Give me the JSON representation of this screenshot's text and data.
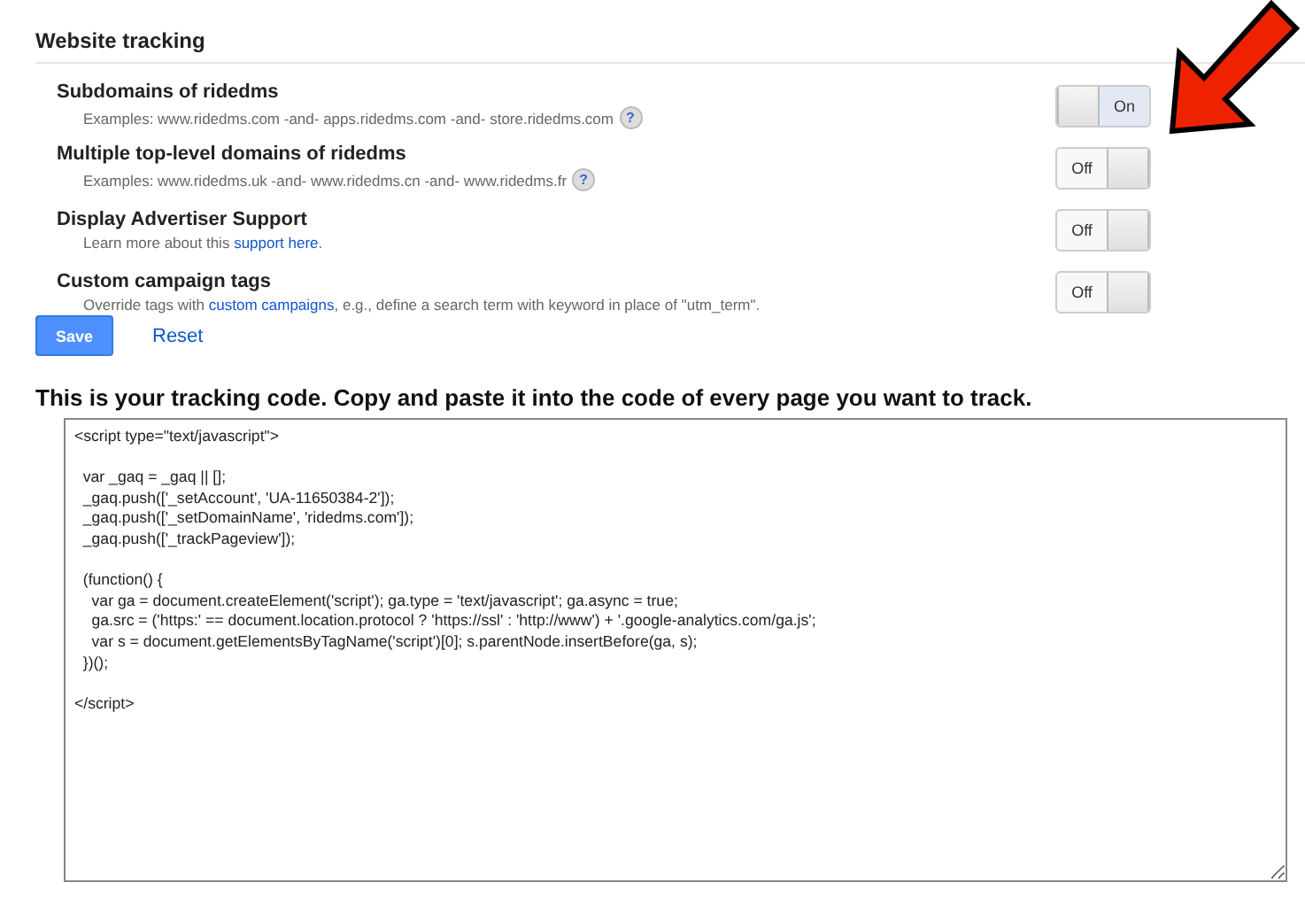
{
  "section_title": "Website tracking",
  "settings": [
    {
      "title": "Subdomains of ridedms",
      "description": [
        {
          "text": "Examples: www.ridedms.com -and- apps.ridedms.com -and- store.ridedms.com"
        }
      ],
      "help": "?",
      "on": true,
      "toggle_label": "On"
    },
    {
      "title": "Multiple top-level domains of ridedms",
      "description": [
        {
          "text": "Examples: www.ridedms.uk -and- www.ridedms.cn -and- www.ridedms.fr"
        }
      ],
      "help": "?",
      "on": false,
      "toggle_label": "Off"
    },
    {
      "title": "Display Advertiser Support",
      "description": [
        {
          "text": "Learn more about this "
        },
        {
          "link": "support here"
        },
        {
          "text": "."
        }
      ],
      "on": false,
      "toggle_label": "Off"
    },
    {
      "title": "Custom campaign tags",
      "description": [
        {
          "text": "Override tags with "
        },
        {
          "link": "custom campaigns"
        },
        {
          "text": ", e.g., define a search term with keyword in place of \"utm_term\"."
        }
      ],
      "on": false,
      "toggle_label": "Off"
    }
  ],
  "buttons": {
    "save": "Save",
    "reset": "Reset"
  },
  "code_heading": "This is your tracking code. Copy and paste it into the code of every page you want to track.",
  "code_blocks": [
    [
      "<script type=\"text/javascript\">"
    ],
    [
      "  var _gaq = _gaq || [];",
      "  _gaq.push(['_setAccount', 'UA-11650384-2']);",
      "  _gaq.push(['_setDomainName', 'ridedms.com']);",
      "  _gaq.push(['_trackPageview']);"
    ],
    [
      "  (function() {",
      "    var ga = document.createElement('script'); ga.type = 'text/javascript'; ga.async = true;",
      "    ga.src = ('https:' == document.location.protocol ? 'https://ssl' : 'http://www') + '.google-analytics.com/ga.js';",
      "    var s = document.getElementsByTagName('script')[0]; s.parentNode.insertBefore(ga, s);",
      "  })();"
    ],
    [
      "</script>"
    ]
  ]
}
